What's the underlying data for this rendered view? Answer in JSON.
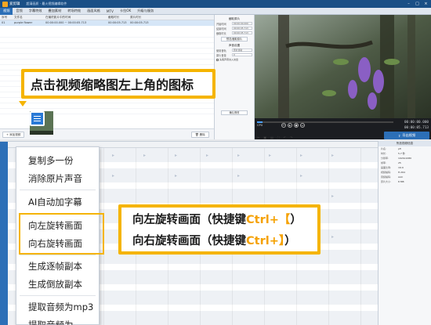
{
  "app": {
    "title": "爱剪辑",
    "document_title": "超清画质 · 最火视频编辑软件"
  },
  "menu": {
    "items": [
      "视频",
      "音频",
      "字幕特效",
      "叠加素材",
      "转场特效",
      "画面风格",
      "MTV",
      "卡拉OK",
      "升级与服务"
    ]
  },
  "media_list": {
    "columns": [
      "序号",
      "文件名",
      "在最终影片中的时间",
      "截取时长",
      "原片时长"
    ],
    "rows": [
      {
        "index": "01",
        "name": "purple flower",
        "time": "00:00:00.000 ~ 00:00:05.713",
        "trim": "00:00:05.713",
        "orig": "00:00:05.713"
      }
    ],
    "add_button": "添加视频",
    "delete_button": "删除"
  },
  "settings": {
    "trim_group": "截取原片",
    "start_label": "开始时间",
    "start_value": "00:00:00.000",
    "end_label": "结束时间",
    "end_value": "00:00:05.713",
    "duration_label": "截取时长",
    "duration_value": "00:00:05.713",
    "preview_button": "预览/截取原片",
    "audio_group": "声音设置",
    "track_label": "使用音轨",
    "track_value": "原片音轨",
    "volume_label": "原片音量",
    "volume_value": "0",
    "head_tail_label": "头尾声音淡入淡出",
    "confirm_button": "确认修改"
  },
  "player": {
    "time_current": "00:00:00.000",
    "time_total": "00:00:05.713",
    "frame_label": "CPU",
    "progress_fraction": 0.04
  },
  "export": {
    "button": "导出视频"
  },
  "properties": {
    "title": "所选视频信息",
    "rows": [
      {
        "k": "片名:",
        "v": "pfl"
      },
      {
        "k": "时长:",
        "v": "5.7 秒"
      },
      {
        "k": "分辨率:",
        "v": "1920x1080"
      },
      {
        "k": "帧率:",
        "v": "25"
      },
      {
        "k": "画面比例:",
        "v": "16:9"
      },
      {
        "k": "视频编码:",
        "v": "H.264"
      },
      {
        "k": "音频编码:",
        "v": "AAC"
      },
      {
        "k": "原片大小:",
        "v": "8 MB"
      }
    ]
  },
  "callouts": {
    "top": "点击视频缩略图左上角的图标",
    "right_line1_text": "向左旋转画面（快捷键",
    "right_line1_key": "Ctrl+【",
    "right_line1_end": "）",
    "right_line2_text": "向右旋转画面（快捷键",
    "right_line2_key": "Ctrl+】",
    "right_line2_end": "）"
  },
  "context_menu": {
    "items": [
      "复制多一份",
      "消除原片声音",
      "AI自动加字幕",
      "向左旋转画面",
      "向右旋转画面",
      "生成逐帧副本",
      "生成倒放副本",
      "提取音频为mp3",
      "提取音频为"
    ]
  },
  "colors": {
    "accent_yellow": "#f5b400",
    "brand_blue": "#2c6fb7",
    "title_blue": "#1a4f86"
  }
}
